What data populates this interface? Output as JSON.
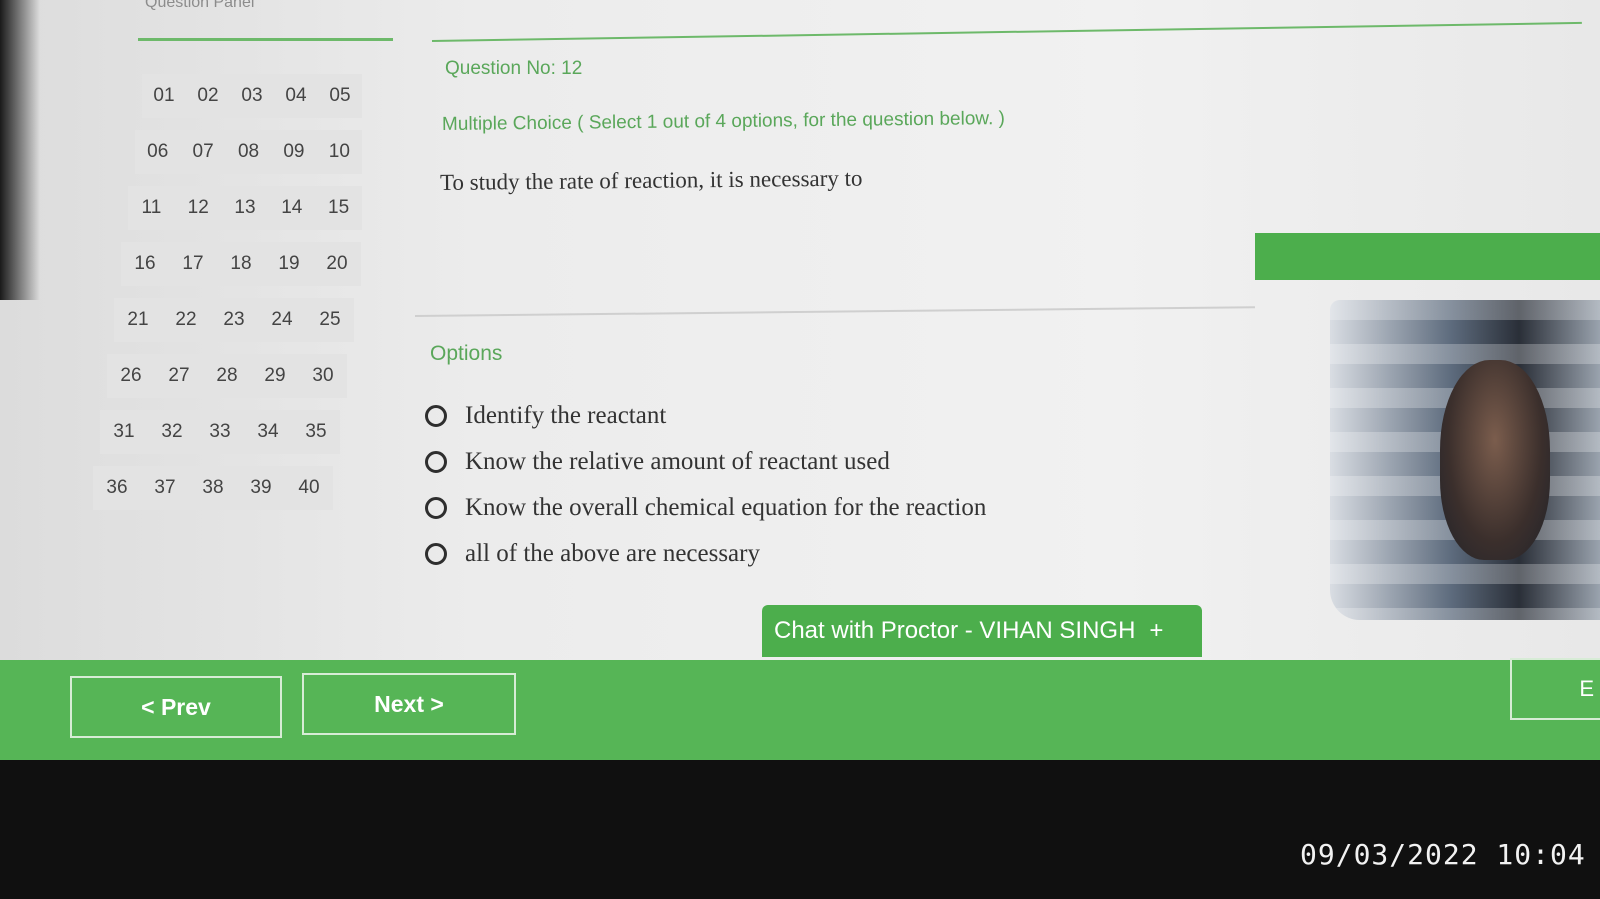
{
  "question_panel": {
    "title": "Question Panel",
    "numbers": [
      [
        "01",
        "02",
        "03",
        "04",
        "05"
      ],
      [
        "06",
        "07",
        "08",
        "09",
        "10"
      ],
      [
        "11",
        "12",
        "13",
        "14",
        "15"
      ],
      [
        "16",
        "17",
        "18",
        "19",
        "20"
      ],
      [
        "21",
        "22",
        "23",
        "24",
        "25"
      ],
      [
        "26",
        "27",
        "28",
        "29",
        "30"
      ],
      [
        "31",
        "32",
        "33",
        "34",
        "35"
      ],
      [
        "36",
        "37",
        "38",
        "39",
        "40"
      ]
    ]
  },
  "question": {
    "number_label": "Question No: 12",
    "type_label": "Multiple Choice ( Select 1 out of 4 options, for the question below. )",
    "text": "To study the rate of reaction, it is necessary to"
  },
  "options": {
    "label": "Options",
    "items": [
      "Identify the reactant",
      "Know the relative amount of reactant used",
      "Know the overall chemical equation for the reaction",
      "all of the above are necessary"
    ]
  },
  "chat": {
    "label": "Chat with Proctor - VIHAN SINGH",
    "plus": "+"
  },
  "footer": {
    "prev_label": "< Prev",
    "next_label": "Next >",
    "end_label": "E"
  },
  "camera_timestamp": "09/03/2022 10:04",
  "colors": {
    "accent_green": "#56b556",
    "text_green": "#5aa75a"
  }
}
